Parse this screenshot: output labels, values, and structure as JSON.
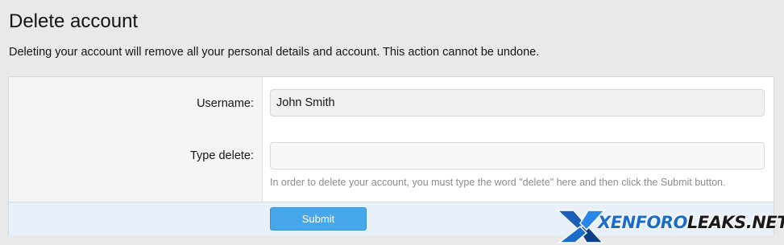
{
  "page": {
    "title": "Delete account",
    "description": "Deleting your account will remove all your personal details and account. This action cannot be undone."
  },
  "form": {
    "username_label": "Username:",
    "username_value": "John Smith",
    "type_delete_label": "Type delete:",
    "type_delete_value": "",
    "type_delete_hint": "In order to delete your account, you must type the word \"delete\" here and then click the Submit button.",
    "submit_label": "Submit"
  },
  "watermark": {
    "part1": "XENFORO",
    "part2": "LEAKS.NET"
  },
  "colors": {
    "submit_button": "#47a7eb",
    "footer_background": "#e8f1fa",
    "watermark_blue": "#1b6dcc"
  },
  "icons": {
    "watermark_mark": "x-logo-mark"
  }
}
